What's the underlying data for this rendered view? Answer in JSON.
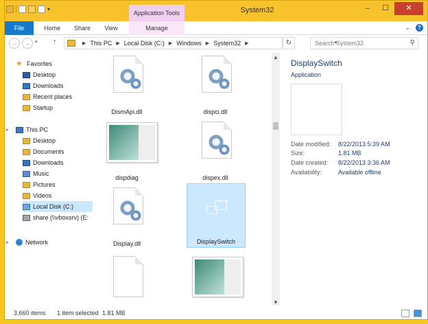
{
  "window": {
    "title": "System32",
    "context_tab": "Application Tools",
    "buttons": {
      "minimize": "–",
      "maximize": "☐",
      "close": "✕"
    }
  },
  "ribbon": {
    "tabs": [
      "File",
      "Home",
      "Share",
      "View",
      "Manage"
    ],
    "expand": "⌄",
    "help": "?"
  },
  "address": {
    "crumbs": [
      "This PC",
      "Local Disk (C:)",
      "Windows",
      "System32"
    ],
    "search_placeholder": "Search System32"
  },
  "nav": {
    "favorites": {
      "label": "Favorites",
      "items": [
        "Desktop",
        "Downloads",
        "Recent places",
        "Startup"
      ]
    },
    "this_pc": {
      "label": "This PC",
      "items": [
        "Desktop",
        "Documents",
        "Downloads",
        "Music",
        "Pictures",
        "Videos",
        "Local Disk (C:)",
        "share (\\\\vboxsrv) (E:"
      ]
    },
    "network": "Network"
  },
  "files": [
    {
      "name": "DismApi.dll",
      "icon": "gear-doc"
    },
    {
      "name": "dispci.dll",
      "icon": "gear-doc"
    },
    {
      "name": "dispdiag",
      "icon": "window-thumb"
    },
    {
      "name": "dispex.dll",
      "icon": "gear-doc"
    },
    {
      "name": "Display.dll",
      "icon": "gear-doc"
    },
    {
      "name": "DisplaySwitch",
      "icon": "display-switch",
      "selected": true
    },
    {
      "name": "",
      "icon": "blank-doc"
    },
    {
      "name": "",
      "icon": "window-thumb"
    }
  ],
  "details": {
    "name": "DisplaySwitch",
    "type": "Application",
    "rows": [
      {
        "key": "Date modified:",
        "value": "8/22/2013 5:39 AM"
      },
      {
        "key": "Size:",
        "value": "1.81 MB"
      },
      {
        "key": "Date created:",
        "value": "8/22/2013 3:36 AM"
      },
      {
        "key": "Availability:",
        "value": "Available offline"
      }
    ]
  },
  "status": {
    "items": "3,660 items",
    "selected": "1 item selected",
    "size": "1.81 MB"
  },
  "colors": {
    "titlebar": "#f7c22b",
    "file_tab": "#1979ca",
    "selection": "#cce8ff",
    "close": "#c7402c"
  }
}
